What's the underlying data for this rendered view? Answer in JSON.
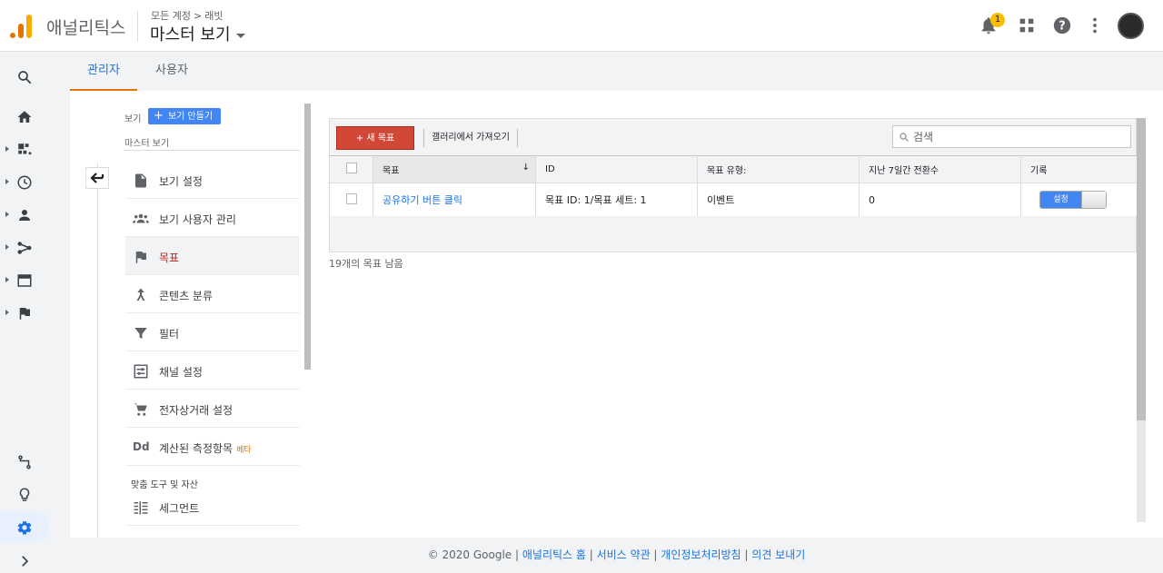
{
  "header": {
    "app_title": "애널리틱스",
    "breadcrumb": [
      "모든 계정",
      "래빗"
    ],
    "breadcrumb_separator": ">",
    "view_name": "마스터 보기",
    "notification_count": "1",
    "icons": [
      "bell-icon",
      "apps-grid-icon",
      "help-icon",
      "more-vert-icon",
      "avatar"
    ]
  },
  "rail": {
    "items": [
      "search-icon",
      "home-icon",
      "customization-icon",
      "realtime-clock-icon",
      "audience-person-icon",
      "acquisition-icon",
      "behavior-icon",
      "conversions-flag-icon"
    ],
    "bottom_items": [
      "attribution-icon",
      "discover-lightbulb-icon",
      "admin-gear-icon",
      "expand-chevron-icon"
    ]
  },
  "tabs": [
    {
      "label": "관리자",
      "active": true
    },
    {
      "label": "사용자",
      "active": false
    }
  ],
  "admin_nav": {
    "view_label": "보기",
    "create_view_button": "보기 만들기",
    "master_view_label": "마스터 보기",
    "items": [
      {
        "label": "보기 설정",
        "icon": "document-icon"
      },
      {
        "label": "보기 사용자 관리",
        "icon": "people-icon"
      },
      {
        "label": "목표",
        "icon": "flag-icon",
        "active": true
      },
      {
        "label": "콘텐츠 분류",
        "icon": "content-grouping-icon"
      },
      {
        "label": "필터",
        "icon": "filter-icon"
      },
      {
        "label": "채널 설정",
        "icon": "channel-settings-icon"
      },
      {
        "label": "전자상거래 설정",
        "icon": "cart-icon"
      },
      {
        "label": "계산된 측정항목",
        "icon": "dd-icon",
        "badge": "베타"
      }
    ],
    "section_label": "맞춤 도구 및 자산",
    "segment_item": {
      "label": "세그먼트",
      "icon": "segment-icon"
    }
  },
  "goals": {
    "new_goal_button": "+ 새 목표",
    "import_button": "갤러리에서 가져오기",
    "search_placeholder": "검색",
    "columns": [
      "목표",
      "ID",
      "목표 유형:",
      "지난 7일간 전환수",
      "기록"
    ],
    "sort_indicator": "↓",
    "rows": [
      {
        "goal": "공유하기 버튼 클릭",
        "id": "목표 ID: 1/목표 세트: 1",
        "type": "이벤트",
        "conversions": "0",
        "toggle_label": "설정",
        "toggle_on": true
      }
    ],
    "remaining": "19개의 목표 남음"
  },
  "footer": {
    "copyright": "© 2020 Google",
    "links": [
      "애널리틱스 홈",
      "서비스 약관",
      "개인정보처리방침",
      "의견 보내기"
    ],
    "separator": " | "
  },
  "colors": {
    "accent_blue": "#1a73e8",
    "new_goal_red": "#d14836",
    "active_tab_underline": "#e37400",
    "badge_yellow": "#fbbc04"
  }
}
